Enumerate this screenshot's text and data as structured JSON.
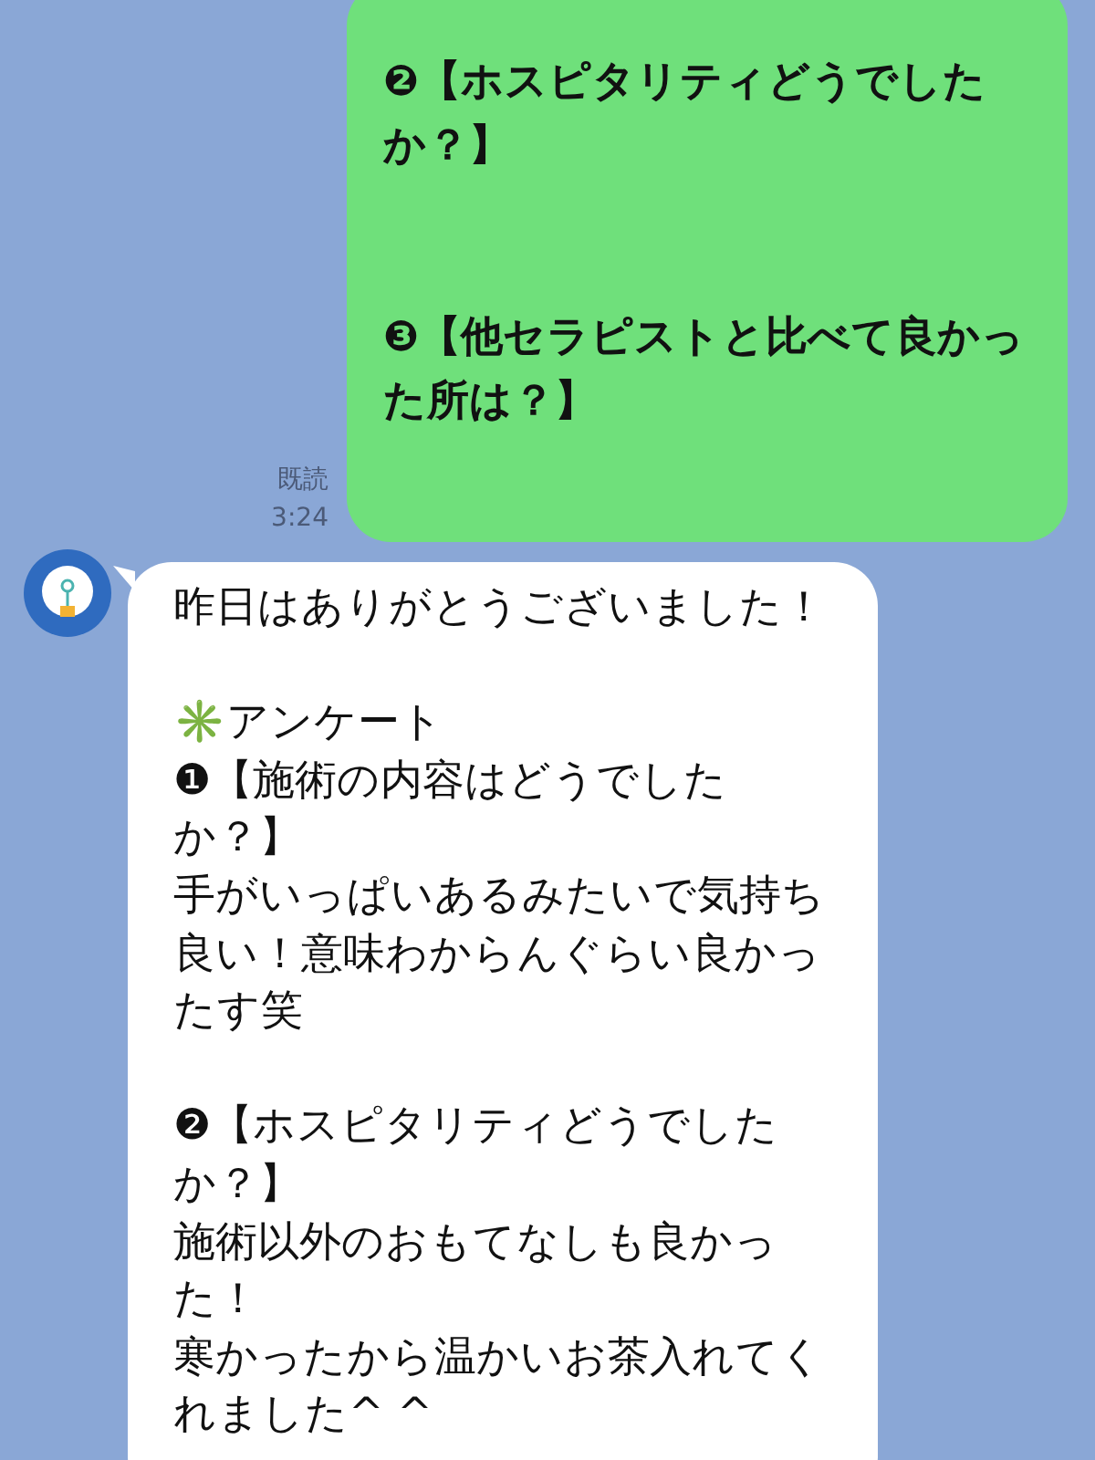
{
  "messages": [
    {
      "kind": "sent",
      "groups": [
        [
          "❷【ホスピタリティどうでしたか？】"
        ],
        [
          "❸【他セラピストと比べて良かった所は？】"
        ]
      ],
      "read_label": "既読",
      "time": "3:24"
    },
    {
      "kind": "received",
      "groups": [
        [
          "昨日はありがとうございました！"
        ],
        [
          "✳️アンケート",
          "❶【施術の内容はどうでしたか？】",
          "手がいっぱいあるみたいで気持ち良い！意味わからんぐらい良かったす笑"
        ],
        [
          "❷【ホスピタリティどうでしたか？】",
          "施術以外のおもてなしも良かった！",
          "寒かったから温かいお茶入れてくれました^ ^"
        ]
      ]
    }
  ]
}
